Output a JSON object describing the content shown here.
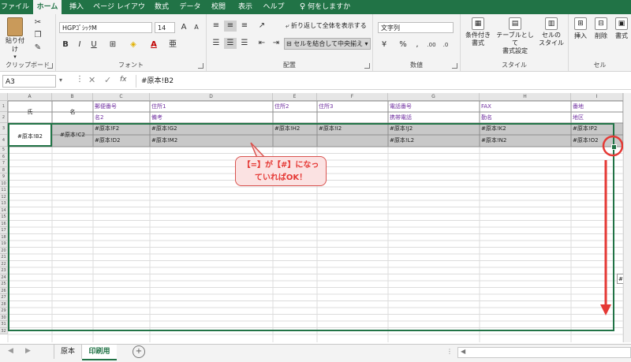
{
  "ribbon_tabs": [
    "ファイル",
    "ホーム",
    "挿入",
    "ページ レイアウト",
    "数式",
    "データ",
    "校閲",
    "表示",
    "ヘルプ",
    "何をしますか"
  ],
  "clipboard": {
    "paste": "貼り付け",
    "label": "クリップボード"
  },
  "font": {
    "name": "HGPｺﾞｼｯｸM",
    "size": "14",
    "bold": "B",
    "italic": "I",
    "underline": "U",
    "grow": "A",
    "shrink": "A",
    "color_a": "A",
    "label": "フォント"
  },
  "alignment": {
    "wrap": "折り返して全体を表示する",
    "merge": "セルを結合して中央揃え",
    "label": "配置"
  },
  "number": {
    "format": "文字列",
    "percent": "%",
    "comma": ",",
    "label": "数値"
  },
  "styles": {
    "conditional": "条件付き\n書式",
    "table": "テーブルとして\n書式設定",
    "cell": "セルの\nスタイル",
    "label": "スタイル"
  },
  "cells": {
    "insert": "挿入",
    "delete": "削除",
    "format": "書式",
    "label": "セル"
  },
  "formula_bar": {
    "name_box": "A3",
    "fx": "fx",
    "formula": "#原本!B2"
  },
  "columns": [
    "A",
    "B",
    "C",
    "D",
    "E",
    "F",
    "G",
    "H",
    "I"
  ],
  "rows": [
    "1",
    "2",
    "3",
    "4",
    "5",
    "6",
    "7",
    "8",
    "9",
    "10",
    "11",
    "12",
    "13",
    "14",
    "15",
    "16",
    "17",
    "18",
    "19",
    "20",
    "21",
    "22",
    "23",
    "24",
    "25",
    "26",
    "27",
    "28",
    "29",
    "30",
    "31",
    "32"
  ],
  "header_row1": {
    "a": "氏",
    "b": "名",
    "c": "郵便番号",
    "d": "住所1",
    "e": "住所2",
    "f": "住所3",
    "g": "電話番号",
    "h": "FAX",
    "i": "番地"
  },
  "header_row2": {
    "c": "名2",
    "d": "備考",
    "g": "携帯電話",
    "h": "勤名",
    "i": "地区"
  },
  "data_row1": {
    "a": "#原本!B2",
    "b": "#原本!C2",
    "c": "#原本!F2",
    "d": "#原本!G2",
    "e": "#原本!H2",
    "f": "#原本!I2",
    "g": "#原本!J2",
    "h": "#原本!K2",
    "i": "#原本!P2"
  },
  "data_row2": {
    "c": "#原本!D2",
    "d": "#原本!M2",
    "g": "#原本!L2",
    "h": "#原本!N2",
    "i": "#原本!O2"
  },
  "callout": "【=】が【#】になっ\nていればOK！",
  "side_peek": "#原本",
  "sheets": [
    "原本",
    "印刷用"
  ],
  "add_sheet": "+",
  "colors": {
    "accent": "#217346",
    "callout_border": "#d9534f",
    "callout_fill": "#fbe2e2",
    "annotation": "#e53935",
    "selection": "#c8c8c8",
    "header_text": "#7030a0"
  }
}
